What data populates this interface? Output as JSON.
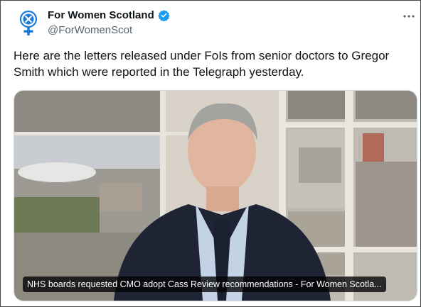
{
  "author": {
    "display_name": "For Women Scotland",
    "handle": "@ForWomenScot",
    "verified": true,
    "avatar_icon": "women-symbol-logo-icon",
    "brand_color": "#1c7ad8"
  },
  "tweet": {
    "text": "Here are the letters released under FoIs from senior doctors to Gregor Smith which were reported in the Telegraph yesterday."
  },
  "link_card": {
    "caption": "NHS boards requested CMO adopt Cass Review recommendations - For Women Scotla..."
  },
  "menu": {
    "icon": "more-options-icon"
  },
  "colors": {
    "verified_badge": "#1d9bf0",
    "text_primary": "#0f1419",
    "text_secondary": "#536471"
  }
}
